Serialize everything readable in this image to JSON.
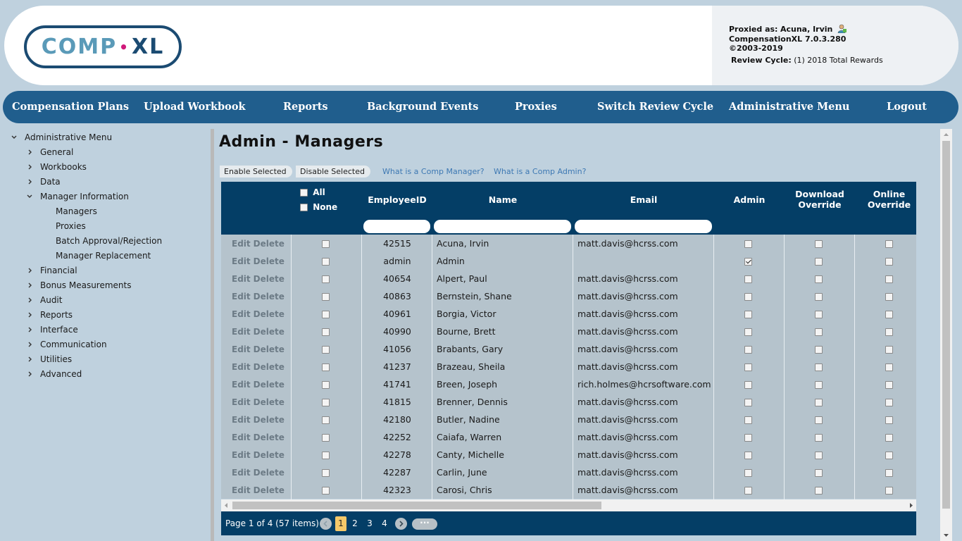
{
  "header": {
    "logo_text_a": "COMP",
    "logo_dot": "•",
    "logo_text_b": "XL",
    "proxied_label": "Proxied as:",
    "proxied_name": "Acuna, Irvin",
    "version": "CompensationXL 7.0.3.280",
    "copyright": "©2003-2019",
    "review_label": "Review Cycle:",
    "review_value": "(1) 2018 Total Rewards"
  },
  "nav": [
    {
      "label": "Compensation Plans"
    },
    {
      "label": "Upload Workbook"
    },
    {
      "label": "Reports"
    },
    {
      "label": "Background Events"
    },
    {
      "label": "Proxies"
    },
    {
      "label": "Switch Review Cycle"
    },
    {
      "label": "Administrative Menu"
    },
    {
      "label": "Logout"
    }
  ],
  "sidebar": {
    "items": [
      {
        "label": "Administrative Menu",
        "expanded": true
      },
      {
        "label": "General",
        "expanded": false
      },
      {
        "label": "Workbooks",
        "expanded": false
      },
      {
        "label": "Data",
        "expanded": false
      },
      {
        "label": "Manager Information",
        "expanded": true
      },
      {
        "label": "Managers"
      },
      {
        "label": "Proxies"
      },
      {
        "label": "Batch Approval/Rejection"
      },
      {
        "label": "Manager Replacement"
      },
      {
        "label": "Financial",
        "expanded": false
      },
      {
        "label": "Bonus Measurements",
        "expanded": false
      },
      {
        "label": "Audit",
        "expanded": false
      },
      {
        "label": "Reports",
        "expanded": false
      },
      {
        "label": "Interface",
        "expanded": false
      },
      {
        "label": "Communication",
        "expanded": false
      },
      {
        "label": "Utilities",
        "expanded": false
      },
      {
        "label": "Advanced",
        "expanded": false
      }
    ]
  },
  "main": {
    "title": "Admin - Managers",
    "enable_label": "Enable Selected",
    "disable_label": "Disable Selected",
    "link_manager": "What is a Comp Manager?",
    "link_admin": "What is a Comp Admin?"
  },
  "grid": {
    "select_all": "All",
    "select_none": "None",
    "columns": {
      "employee_id": "EmployeeID",
      "name": "Name",
      "email": "Email",
      "admin": "Admin",
      "download_override_1": "Download",
      "download_override_2": "Override",
      "online_override_1": "Online",
      "online_override_2": "Override"
    },
    "edit_label": "Edit",
    "delete_label": "Delete",
    "rows": [
      {
        "id": "42515",
        "name": "Acuna, Irvin",
        "email": "matt.davis@hcrss.com",
        "admin": false
      },
      {
        "id": "admin",
        "name": "Admin",
        "email": "",
        "admin": true
      },
      {
        "id": "40654",
        "name": "Alpert, Paul",
        "email": "matt.davis@hcrss.com",
        "admin": false
      },
      {
        "id": "40863",
        "name": "Bernstein, Shane",
        "email": "matt.davis@hcrss.com",
        "admin": false
      },
      {
        "id": "40961",
        "name": "Borgia, Victor",
        "email": "matt.davis@hcrss.com",
        "admin": false
      },
      {
        "id": "40990",
        "name": "Bourne, Brett",
        "email": "matt.davis@hcrss.com",
        "admin": false
      },
      {
        "id": "41056",
        "name": "Brabants, Gary",
        "email": "matt.davis@hcrss.com",
        "admin": false
      },
      {
        "id": "41237",
        "name": "Brazeau, Sheila",
        "email": "matt.davis@hcrss.com",
        "admin": false
      },
      {
        "id": "41741",
        "name": "Breen, Joseph",
        "email": "rich.holmes@hcrsoftware.com",
        "admin": false
      },
      {
        "id": "41815",
        "name": "Brenner, Dennis",
        "email": "matt.davis@hcrss.com",
        "admin": false
      },
      {
        "id": "42180",
        "name": "Butler, Nadine",
        "email": "matt.davis@hcrss.com",
        "admin": false
      },
      {
        "id": "42252",
        "name": "Caiafa, Warren",
        "email": "matt.davis@hcrss.com",
        "admin": false
      },
      {
        "id": "42278",
        "name": "Canty, Michelle",
        "email": "matt.davis@hcrss.com",
        "admin": false
      },
      {
        "id": "42287",
        "name": "Carlin, June",
        "email": "matt.davis@hcrss.com",
        "admin": false
      },
      {
        "id": "42323",
        "name": "Carosi, Chris",
        "email": "matt.davis@hcrss.com",
        "admin": false
      }
    ]
  },
  "pager": {
    "info": "Page 1 of 4 (57 items)",
    "pages": [
      "1",
      "2",
      "3",
      "4"
    ],
    "current": "1",
    "more": "···"
  }
}
